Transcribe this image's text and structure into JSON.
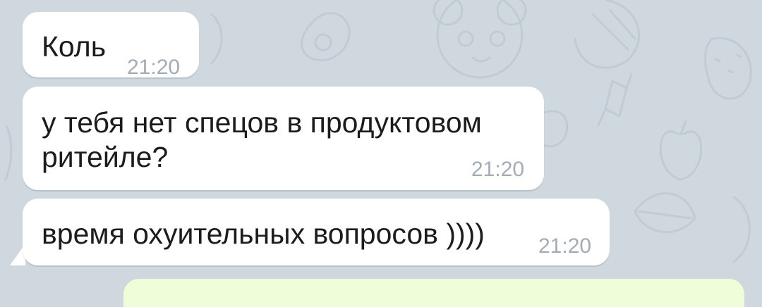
{
  "messages": [
    {
      "text": "Коль",
      "time": "21:20"
    },
    {
      "text": "у тебя нет спецов в продуктовом ритейле?",
      "time": "21:20"
    },
    {
      "text": "время охуительных вопросов ))))",
      "time": "21:20"
    }
  ],
  "colors": {
    "background": "#cfd8df",
    "incoming_bubble": "#ffffff",
    "outgoing_bubble": "#eefed8",
    "timestamp": "#a3acb4",
    "text": "#1c1c1c"
  },
  "wallpaper_icons": [
    "avocado-icon",
    "panda-icon",
    "fruit-icon",
    "candy-icon",
    "apple-icon",
    "strawberry-icon"
  ]
}
